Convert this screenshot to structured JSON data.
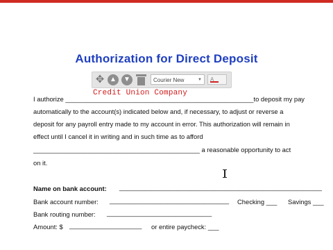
{
  "document": {
    "title": "Authorization for Direct Deposit",
    "line1_prefix": "I authorize ____________________________________________________to deposit my pay",
    "line2": "automatically to the account(s) indicated below and, if necessary, to adjust or reverse a",
    "line3": "deposit for any payroll entry made to my account in error. This authorization will remain in",
    "line4": "effect until I cancel it in writing and in such time as to afford",
    "line5": "______________________________________________ a reasonable opportunity to act",
    "line6": "on it.",
    "name_label": "Name on bank account:",
    "name_line": "________________________________________________________",
    "account_label": "Bank account number:",
    "account_line": "_________________________________",
    "checking": "Checking ___",
    "savings": "Savings ___",
    "routing_label": "Bank routing number:",
    "routing_line": "_____________________________",
    "amount_label": "Amount: $",
    "amount_line": "____________________",
    "paycheck": "or entire paycheck: ___"
  },
  "editor": {
    "field_value": "Credit Union Company",
    "font_name": "Courier New",
    "color_label": "A",
    "move_icon": "move-icon",
    "up_icon": "arrow-up-icon",
    "down_icon": "arrow-down-icon",
    "trash_icon": "trash-icon"
  },
  "colors": {
    "title": "#1f3fbf",
    "field_text": "#d11a1a",
    "top_bar": "#cf2b22"
  }
}
